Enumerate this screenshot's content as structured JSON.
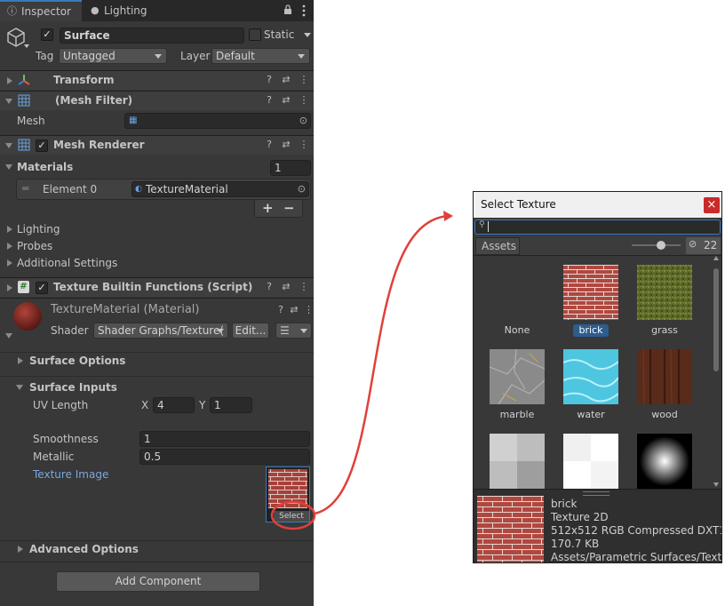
{
  "tabs": [
    {
      "label": "Inspector",
      "active": true,
      "icon": "info-icon"
    },
    {
      "label": "Lighting",
      "active": false,
      "icon": "bulb-icon"
    }
  ],
  "object": {
    "name": "Surface",
    "static_label": "Static",
    "tag_label": "Tag",
    "tag_value": "Untagged",
    "layer_label": "Layer",
    "layer_value": "Default"
  },
  "components": {
    "transform": "Transform",
    "mesh_filter": "(Mesh Filter)",
    "mesh_label": "Mesh",
    "mesh_renderer": "Mesh Renderer",
    "materials_label": "Materials",
    "materials_count": "1",
    "element0_label": "Element 0",
    "element0_value": "TextureMaterial",
    "plus": "+",
    "minus": "−",
    "lighting": "Lighting",
    "probes": "Probes",
    "additional_settings": "Additional Settings",
    "script": "Texture Builtin Functions (Script)"
  },
  "material": {
    "name": "TextureMaterial (Material)",
    "shader_label": "Shader",
    "shader_value": "Shader Graphs/Texture(",
    "edit_label": "Edit...",
    "surface_options": "Surface Options",
    "surface_inputs": "Surface Inputs",
    "uv_length_label": "UV Length",
    "x_label": "X",
    "x_value": "4",
    "y_label": "Y",
    "y_value": "1",
    "smoothness_label": "Smoothness",
    "smoothness_value": "1",
    "metallic_label": "Metallic",
    "metallic_value": "0.5",
    "texture_image_label": "Texture Image",
    "select_label": "Select",
    "advanced_options": "Advanced Options"
  },
  "add_component": "Add Component",
  "picker": {
    "title": "Select Texture",
    "close": "×",
    "search_value": "",
    "assets_tab": "Assets",
    "hidden_count": "22",
    "items": [
      {
        "label": "None",
        "selected": false
      },
      {
        "label": "brick",
        "selected": true
      },
      {
        "label": "grass",
        "selected": false
      },
      {
        "label": "marble",
        "selected": false
      },
      {
        "label": "water",
        "selected": false
      },
      {
        "label": "wood",
        "selected": false
      }
    ],
    "details": {
      "name": "brick",
      "type": "Texture 2D",
      "format": "512x512  RGB Compressed DXT1",
      "size": "170.7 KB",
      "path": "Assets/Parametric Surfaces/Text"
    }
  },
  "colors": {
    "accent": "#3a79bb",
    "annotation": "#e0403a",
    "link_text": "#7aa6e0"
  }
}
